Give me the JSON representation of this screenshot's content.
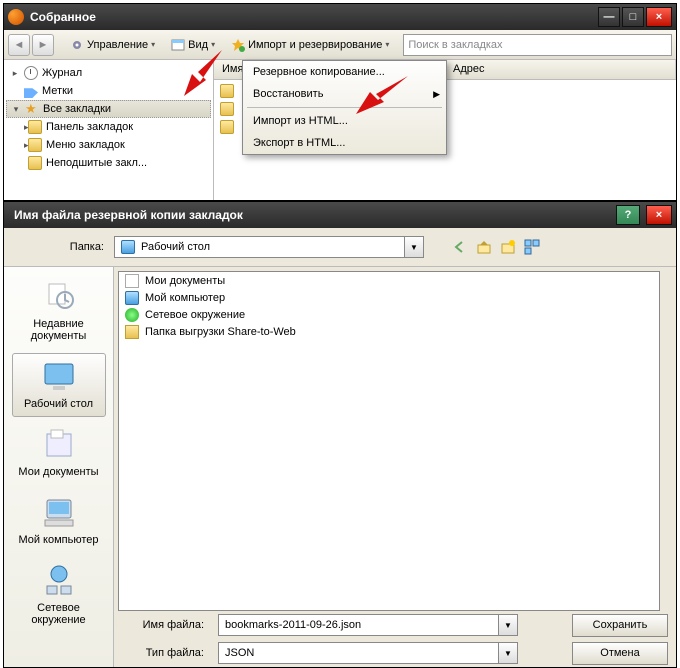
{
  "library": {
    "title": "Собранное",
    "toolbar": {
      "manage": "Управление",
      "view": "Вид",
      "import": "Импорт и резервирование"
    },
    "search_placeholder": "Поиск в закладках",
    "tree": {
      "history": "Журнал",
      "tags": "Метки",
      "all_bookmarks": "Все закладки",
      "toolbar_folder": "Панель закладок",
      "menu_folder": "Меню закладок",
      "unsorted": "Неподшитые закл..."
    },
    "columns": {
      "name": "Имя",
      "address": "Адрес"
    },
    "menu": {
      "backup": "Резервное копирование...",
      "restore": "Восстановить",
      "import_html": "Импорт из HTML...",
      "export_html": "Экспорт в HTML..."
    }
  },
  "save_dialog": {
    "title": "Имя файла резервной копии закладок",
    "folder_label": "Папка:",
    "folder_value": "Рабочий стол",
    "places": {
      "recent": "Недавние документы",
      "desktop": "Рабочий стол",
      "mydocs": "Мои документы",
      "mycomp": "Мой компьютер",
      "network": "Сетевое окружение"
    },
    "files": {
      "mydocs": "Мои документы",
      "mycomp": "Мой компьютер",
      "network": "Сетевое окружение",
      "share": "Папка выгрузки Share-to-Web"
    },
    "filename_label": "Имя файла:",
    "filename_value": "bookmarks-2011-09-26.json",
    "filetype_label": "Тип файла:",
    "filetype_value": "JSON",
    "save_btn": "Сохранить",
    "cancel_btn": "Отмена"
  }
}
